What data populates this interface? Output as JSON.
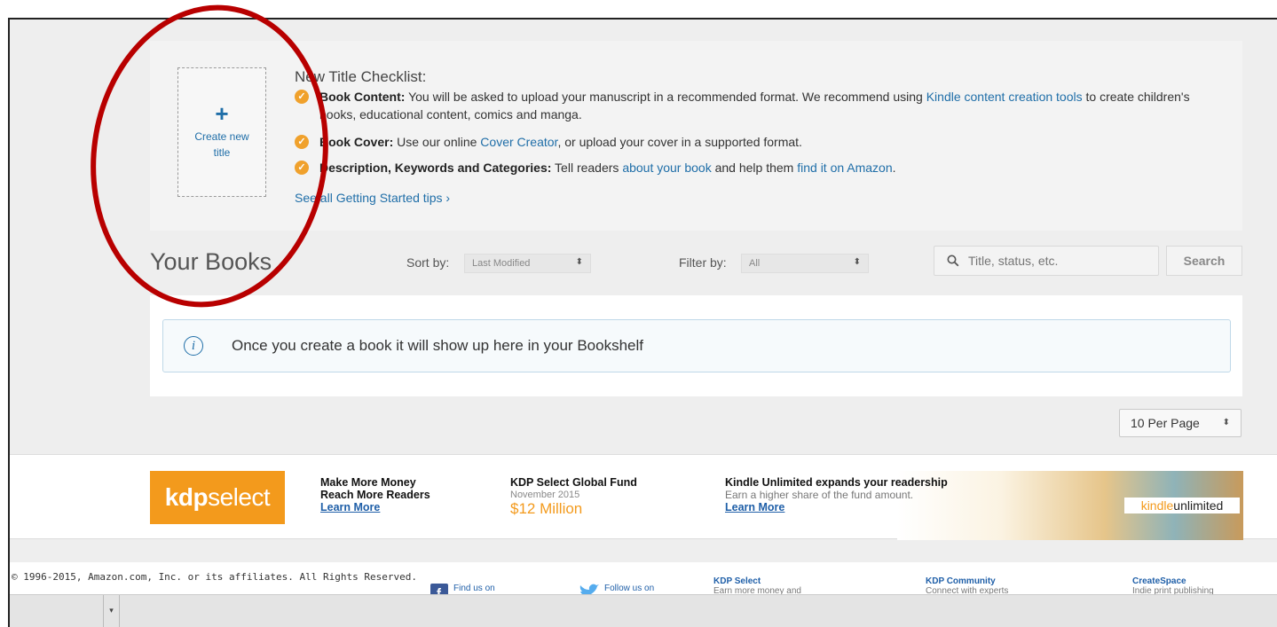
{
  "checklist": {
    "create_tile": {
      "plus": "+",
      "label": "Create new title"
    },
    "title": "New Title Checklist:",
    "items": [
      {
        "bold": "Book Content:",
        "text1": " You will be asked to upload your manuscript in a recommended format. We recommend using ",
        "link1": "Kindle content creation tools",
        "text2": " to create children's books, educational content, comics and manga."
      },
      {
        "bold": "Book Cover:",
        "text1": " Use our online ",
        "link1": "Cover Creator",
        "text2": ", or upload your cover in a supported format."
      },
      {
        "bold": "Description, Keywords and Categories:",
        "text1": " Tell readers ",
        "link1": "about your book",
        "text2": " and help them ",
        "link2": "find it on Amazon",
        "text3": "."
      }
    ],
    "see_all": "See all Getting Started tips ›"
  },
  "books": {
    "title": "Your Books",
    "sort_label": "Sort by:",
    "sort_value": "Last Modified",
    "filter_label": "Filter by:",
    "filter_value": "All",
    "search_placeholder": "Title, status, etc.",
    "search_button": "Search",
    "empty_message": "Once you create a book it will show up here in your Bookshelf",
    "per_page": "10 Per Page"
  },
  "banner": {
    "logo_a": "kdp",
    "logo_b": "select",
    "promo1": {
      "line1": "Make More Money",
      "line2": "Reach More Readers",
      "link": "Learn More"
    },
    "promo2": {
      "title": "KDP Select Global Fund",
      "date": "November 2015",
      "amount": "$12 Million"
    },
    "promo3": {
      "title": "Kindle Unlimited expands your readership",
      "sub": "Earn a higher share of the fund amount.",
      "link": "Learn More"
    },
    "ku_logo_a": "kindle",
    "ku_logo_b": "unlimited"
  },
  "footer": {
    "copyright": "© 1996-2015, Amazon.com, Inc. or its affiliates. All Rights Reserved.",
    "facebook": "Find us on",
    "twitter": "Follow us on",
    "cols": [
      {
        "title": "KDP Select",
        "sub": "Earn more money and"
      },
      {
        "title": "KDP Community",
        "sub": "Connect with experts"
      },
      {
        "title": "CreateSpace",
        "sub": "Indie print publishing"
      }
    ]
  },
  "colors": {
    "accent_orange": "#f39a1c",
    "link_blue": "#1f6ea8",
    "annotation_red": "#b80000"
  }
}
